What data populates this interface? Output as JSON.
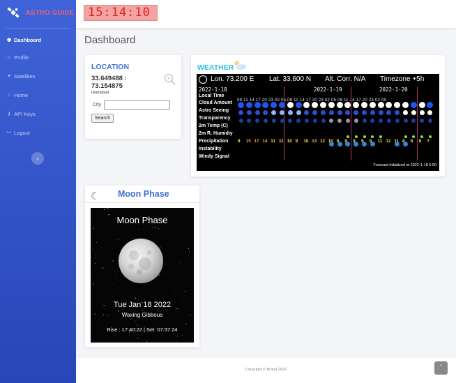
{
  "brand": {
    "name": "ASTRO GUIDE",
    "icon": "satellite-icon"
  },
  "sidebar": {
    "items": [
      {
        "label": "Dashboard",
        "icon": "dashboard-icon",
        "active": true
      },
      {
        "label": "Profile",
        "icon": "user-icon"
      },
      {
        "label": "Satellites",
        "icon": "satellite-small-icon"
      },
      {
        "label": "Home",
        "icon": "home-icon"
      },
      {
        "label": "API Keys",
        "icon": "key-icon"
      },
      {
        "label": "Logout",
        "icon": "logout-icon"
      }
    ],
    "toggle_icon": "chevron-left-icon"
  },
  "topbar": {
    "clock": "15:14:10"
  },
  "page": {
    "title": "Dashboard"
  },
  "location": {
    "title": "LOCATION",
    "coords": "33.649488 : 73.154875",
    "city": "Islamabad",
    "city_label": "City",
    "city_value": "",
    "search_label": "Search"
  },
  "weather": {
    "title": "WEATHER",
    "header": {
      "lon": "Lon. 73.200 E",
      "lat": "Lat. 33.600 N",
      "alt": "Alt. Corr. N/A",
      "tz": "Timezone +5h"
    },
    "dates": [
      "2022-1-18",
      "2022-1-19",
      "2022-1-20"
    ],
    "hours": "08 11 14 17 20 23 02 05 08 11 14 17 20 23 02 05 08 11 14 17 20 23 02 05",
    "rows": [
      "Local Time",
      "Cloud Amount",
      "Astro Seeing",
      "Transparency",
      "2m Temp (C)",
      "2m R. Humidiy",
      "Precipitation",
      "Instability",
      "Windy Signal"
    ],
    "temps": [
      "9",
      "15",
      "17",
      "14",
      "11",
      "11",
      "10",
      "9",
      "10",
      "13",
      "12",
      "10",
      "9",
      "9",
      "9",
      "9",
      "9",
      "11",
      "12",
      "11",
      "8",
      "8",
      "8",
      "7"
    ],
    "forecast_note": "Forecast initialized at 2022-1-18 5:00"
  },
  "moon": {
    "title": "Moon Phase",
    "image_title": "Moon Phase",
    "date": "Tue Jan 18 2022",
    "phase": "Waxing Gibbous",
    "rise_set": "Rise : 17:40:22 | Set: 07:37:24"
  },
  "footer": {
    "copyright": "Copyright © Brand 2022",
    "scroll_icon": "chevron-up-icon"
  },
  "colors": {
    "sidebar_top": "#3f63d8",
    "sidebar_bottom": "#2746b8",
    "brand": "#f0607a",
    "clock_bg": "#f4a3a3",
    "clock_text": "#e01f1f",
    "accent": "#3d6fd8",
    "weather_title": "#2ec0e5"
  }
}
